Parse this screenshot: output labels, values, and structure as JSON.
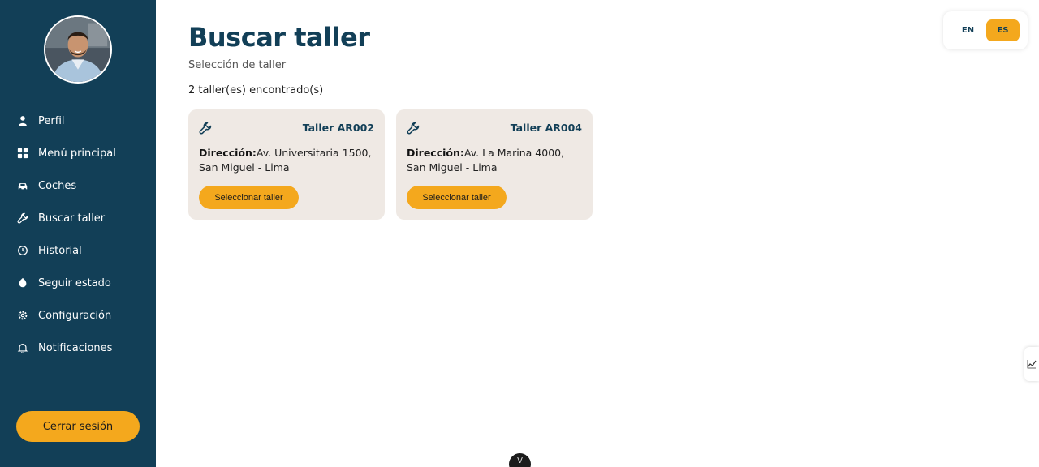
{
  "sidebar": {
    "items": [
      {
        "label": "Perfil",
        "icon": "user-icon"
      },
      {
        "label": "Menú principal",
        "icon": "grid-icon"
      },
      {
        "label": "Coches",
        "icon": "car-icon"
      },
      {
        "label": "Buscar taller",
        "icon": "wrench-icon"
      },
      {
        "label": "Historial",
        "icon": "history-icon"
      },
      {
        "label": "Seguir estado",
        "icon": "location-icon"
      },
      {
        "label": "Configuración",
        "icon": "gear-icon"
      },
      {
        "label": "Notificaciones",
        "icon": "bell-icon"
      }
    ],
    "logout_label": "Cerrar sesión"
  },
  "main": {
    "title": "Buscar taller",
    "subtitle": "Selección de taller",
    "count_text": "2 taller(es) encontrado(s)",
    "address_label": "Dirección:",
    "cards": [
      {
        "name": "Taller AR002",
        "address": "Av. Universitaria 1500, San Miguel - Lima",
        "button": "Seleccionar taller"
      },
      {
        "name": "Taller AR004",
        "address": "Av. La Marina 4000, San Miguel - Lima",
        "button": "Seleccionar taller"
      }
    ]
  },
  "language": {
    "options": [
      "EN",
      "ES"
    ],
    "selected": "ES"
  },
  "bubble_glyph": "V",
  "colors": {
    "sidebar": "#123f57",
    "accent": "#f4a81d",
    "card": "#efe9e4",
    "title": "#123f57"
  }
}
